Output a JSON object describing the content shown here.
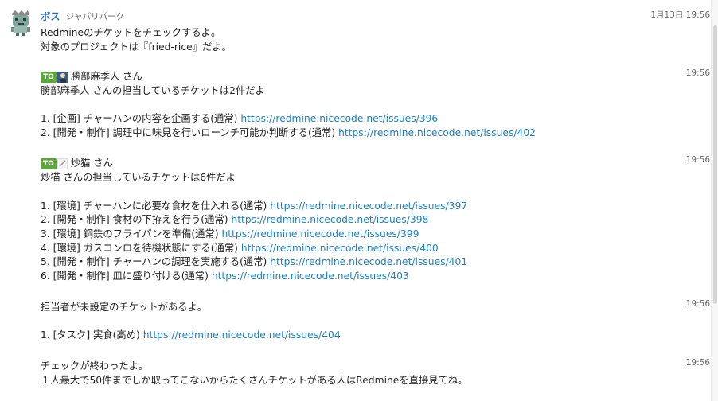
{
  "header": {
    "sender": "ボス",
    "team": "ジャパリパーク",
    "date": "1月13日 19:56"
  },
  "messages": [
    {
      "time": "",
      "lines": [
        "Redmineのチケットをチェックするよ。",
        "対象のプロジェクトは『fried-rice』だよ。"
      ]
    },
    {
      "time": "19:56",
      "to_label": "TO",
      "to_name": "勝部麻季人 さん",
      "summary": "勝部麻季人 さんの担当しているチケットは2件だよ",
      "items": [
        {
          "text": "1. [企画] チャーハンの内容を企画する(通常) ",
          "url": "https://redmine.nicecode.net/issues/396"
        },
        {
          "text": "2. [開発・制作] 調理中に味見を行いローンチ可能か判断する(通常) ",
          "url": "https://redmine.nicecode.net/issues/402"
        }
      ]
    },
    {
      "time": "19:56",
      "to_label": "TO",
      "to_name": "炒猫 さん",
      "summary": "炒猫 さんの担当しているチケットは6件だよ",
      "items": [
        {
          "text": "1. [環境] チャーハンに必要な食材を仕入れる(通常) ",
          "url": "https://redmine.nicecode.net/issues/397"
        },
        {
          "text": "2. [開発・制作] 食材の下拵えを行う(通常) ",
          "url": "https://redmine.nicecode.net/issues/398"
        },
        {
          "text": "3. [環境] 鋼鉄のフライパンを準備(通常) ",
          "url": "https://redmine.nicecode.net/issues/399"
        },
        {
          "text": "4. [環境] ガスコンロを待機状態にする(通常) ",
          "url": "https://redmine.nicecode.net/issues/400"
        },
        {
          "text": "5. [開発・制作] チャーハンの調理を実施する(通常) ",
          "url": "https://redmine.nicecode.net/issues/401"
        },
        {
          "text": "6. [開発・制作] 皿に盛り付ける(通常) ",
          "url": "https://redmine.nicecode.net/issues/403"
        }
      ]
    },
    {
      "time": "19:56",
      "summary": "担当者が未設定のチケットがあるよ。",
      "items": [
        {
          "text": "1. [タスク] 実食(高め) ",
          "url": "https://redmine.nicecode.net/issues/404"
        }
      ]
    },
    {
      "time": "19:56",
      "lines": [
        "チェックが終わったよ。",
        "１人最大で50件までしか取ってこないからたくさんチケットがある人はRedmineを直接見てね。"
      ]
    }
  ]
}
